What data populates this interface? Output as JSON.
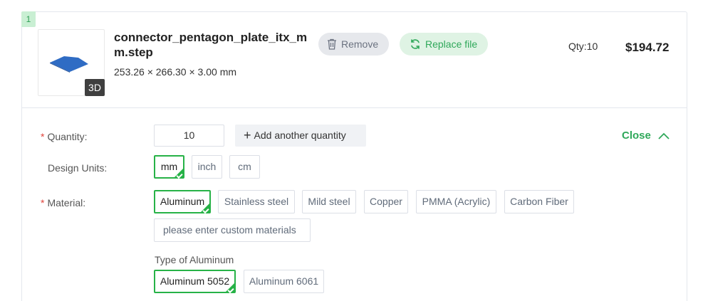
{
  "item": {
    "index": "1",
    "thumbnail_badge": "3D",
    "file_name": "connector_pentagon_plate_itx_mm.step",
    "dimensions": "253.26 × 266.30 × 3.00 mm",
    "remove_label": "Remove",
    "replace_label": "Replace file",
    "qty_summary": "Qty:10",
    "price": "$194.72"
  },
  "form": {
    "quantity": {
      "label": "Quantity:",
      "required_mark": "*",
      "value": "10",
      "add_label": "Add another quantity"
    },
    "close_label": "Close",
    "design_units": {
      "label": "Design Units:",
      "options": [
        "mm",
        "inch",
        "cm"
      ],
      "selected": "mm"
    },
    "material": {
      "label": "Material:",
      "required_mark": "*",
      "options": [
        "Aluminum",
        "Stainless steel",
        "Mild steel",
        "Copper",
        "PMMA (Acrylic)",
        "Carbon Fiber"
      ],
      "selected": "Aluminum",
      "custom_placeholder": "please enter custom materials"
    },
    "material_type": {
      "label": "Type of Aluminum",
      "options": [
        "Aluminum 5052",
        "Aluminum 6061"
      ],
      "selected": "Aluminum 5052"
    }
  },
  "colors": {
    "accent": "#2fa85a",
    "selected_border": "#27b247",
    "required": "#e0443c",
    "model_fill": "#2f6cc4"
  },
  "icons": {
    "remove": "trash-icon",
    "replace": "refresh-icon",
    "add": "plus-icon",
    "close": "chevron-up-icon"
  }
}
